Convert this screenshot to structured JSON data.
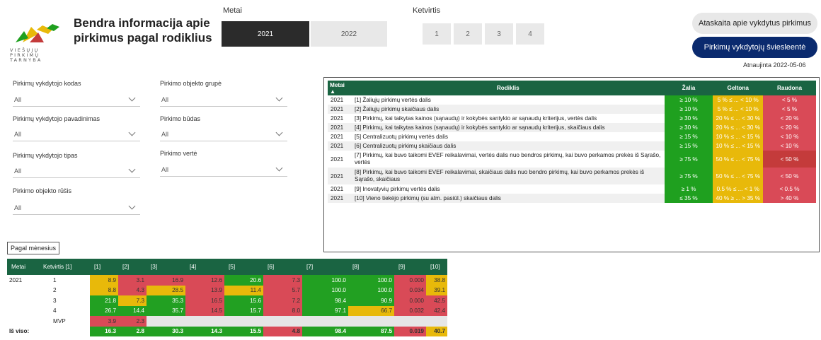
{
  "header": {
    "title": "Bendra informacija apie pirkimus pagal rodiklius",
    "logo_text": "VIEŠŲJŲ\nPIRKIMŲ\nTARNYBA"
  },
  "year_filter": {
    "label": "Metai",
    "options": [
      "2021",
      "2022"
    ],
    "selected": "2021"
  },
  "quarter_filter": {
    "label": "Ketvirtis",
    "options": [
      "1",
      "2",
      "3",
      "4"
    ]
  },
  "buttons": {
    "report": "Ataskaita apie vykdytus pirkimus",
    "traffic_light": "Pirkimų vykdytojų šviesleentė"
  },
  "updated": "Atnaujinta 2022-05-06",
  "filters": [
    {
      "label": "Pirkimų vykdytojo kodas",
      "value": "All"
    },
    {
      "label": "Pirkimo objekto grupė",
      "value": "All"
    },
    {
      "label": "Pirkimų vykdytojo pavadinimas",
      "value": "All"
    },
    {
      "label": "Pirkimo būdas",
      "value": "All"
    },
    {
      "label": "Pirkimų vykdytojo tipas",
      "value": "All"
    },
    {
      "label": "Pirkimo vertė",
      "value": "All"
    },
    {
      "label": "Pirkimo objekto rūšis",
      "value": "All"
    }
  ],
  "indicators": {
    "headers": [
      "Metai",
      "Rodiklis",
      "Žalia",
      "Geltona",
      "Raudona"
    ],
    "rows": [
      {
        "year": "2021",
        "name": "[1] Žaliųjų pirkimų vertės dalis",
        "green": "≥ 10 %",
        "yellow": "5 % ≤ ... < 10 %",
        "red": "< 5 %"
      },
      {
        "year": "2021",
        "name": "[2] Žaliųjų pirkimų skaičiaus dalis",
        "green": "≥ 10 %",
        "yellow": "5 % ≤ ... < 10 %",
        "red": "< 5 %"
      },
      {
        "year": "2021",
        "name": "[3] Pirkimų, kai taikytas kainos (sąnaudų) ir kokybės santykio ar sąnaudų kriterijus, vertės dalis",
        "green": "≥ 30 %",
        "yellow": "20 % ≤ ... < 30 %",
        "red": "< 20 %"
      },
      {
        "year": "2021",
        "name": "[4] Pirkimų, kai taikytas kainos (sąnaudų) ir kokybės santykio ar sąnaudų kriterijus, skaičiaus dalis",
        "green": "≥ 30 %",
        "yellow": "20 % ≤ ... < 30 %",
        "red": "< 20 %"
      },
      {
        "year": "2021",
        "name": "[5] Centralizuotų pirkimų vertės dalis",
        "green": "≥ 15 %",
        "yellow": "10 % ≤ ... < 15 %",
        "red": "< 10 %"
      },
      {
        "year": "2021",
        "name": "[6] Centralizuotų pirkimų skaičiaus dalis",
        "green": "≥ 15 %",
        "yellow": "10 % ≤ ... < 15 %",
        "red": "< 10 %"
      },
      {
        "year": "2021",
        "name": "[7] Pirkimų, kai buvo taikomi EVEF reikalavimai, vertės dalis nuo bendros pirkimų, kai buvo perkamos prekės iš Sąrašo, vertės",
        "green": "≥ 75 %",
        "yellow": "50 % ≤ ... < 75 %",
        "red": "< 50 %"
      },
      {
        "year": "2021",
        "name": "[8] Pirkimų, kai buvo taikomi EVEF reikalavimai, skaičiaus dalis nuo bendro pirkimų, kai buvo perkamos prekės iš Sąrašo, skaičiaus",
        "green": "≥ 75 %",
        "yellow": "50 % ≤ ... < 75 %",
        "red": "< 50 %"
      },
      {
        "year": "2021",
        "name": "[9] Inovatyvių pirkimų vertės dalis",
        "green": "≥ 1 %",
        "yellow": "0.5 % ≤ ... < 1 %",
        "red": "< 0.5 %"
      },
      {
        "year": "2021",
        "name": "[10] Vieno tiekėjo pirkimų (su atm. pasiūl.) skaičiaus dalis",
        "green": "≤ 35 %",
        "yellow": "40 % ≥ ... > 35 %",
        "red": "> 40 %"
      }
    ]
  },
  "monthly": {
    "button": "Pagal mėnesius",
    "headers": [
      "Metai",
      "Ketvirtis [1]",
      "[1]",
      "[2]",
      "[3]",
      "[4]",
      "[5]",
      "[6]",
      "[7]",
      "[8]",
      "[9]",
      "[10]"
    ],
    "rows": [
      {
        "year": "2021",
        "q": "1",
        "v": [
          "8.9",
          "3.1",
          "16.9",
          "12.6",
          "20.6",
          "7.3",
          "100.0",
          "100.0",
          "0.000",
          "38.8"
        ],
        "c": [
          "y",
          "r",
          "r",
          "r",
          "g",
          "r",
          "g",
          "g",
          "r",
          "y"
        ]
      },
      {
        "year": "",
        "q": "2",
        "v": [
          "8.8",
          "4.3",
          "28.5",
          "13.9",
          "11.4",
          "5.7",
          "100.0",
          "100.0",
          "0.034",
          "39.1"
        ],
        "c": [
          "y",
          "r",
          "y",
          "r",
          "y",
          "r",
          "g",
          "g",
          "r",
          "y"
        ]
      },
      {
        "year": "",
        "q": "3",
        "v": [
          "21.8",
          "7.3",
          "35.3",
          "16.5",
          "15.6",
          "7.2",
          "98.4",
          "90.9",
          "0.000",
          "42.5"
        ],
        "c": [
          "g",
          "y",
          "g",
          "r",
          "g",
          "r",
          "g",
          "g",
          "r",
          "r"
        ]
      },
      {
        "year": "",
        "q": "4",
        "v": [
          "26.7",
          "14.4",
          "35.7",
          "14.5",
          "15.7",
          "8.0",
          "97.1",
          "66.7",
          "0.032",
          "42.4"
        ],
        "c": [
          "g",
          "g",
          "g",
          "r",
          "g",
          "r",
          "g",
          "y",
          "r",
          "r"
        ]
      },
      {
        "year": "",
        "q": "MVP",
        "v": [
          "3.9",
          "2.3",
          "",
          "",
          "",
          "",
          "",
          "",
          "",
          ""
        ],
        "c": [
          "r",
          "r",
          "n",
          "n",
          "n",
          "n",
          "n",
          "n",
          "n",
          "n"
        ]
      },
      {
        "year": "Iš viso:",
        "q": "",
        "v": [
          "16.3",
          "2.8",
          "30.3",
          "14.3",
          "15.5",
          "4.8",
          "98.4",
          "87.5",
          "0.019",
          "40.7"
        ],
        "c": [
          "g",
          "g",
          "g",
          "g",
          "g",
          "r",
          "g",
          "g",
          "r",
          "y"
        ]
      }
    ]
  },
  "colors": {
    "header_green": "#1a6442",
    "green": "#1fa01f",
    "yellow": "#e8b90a",
    "red": "#d94a57",
    "navy": "#0a2a6e"
  }
}
